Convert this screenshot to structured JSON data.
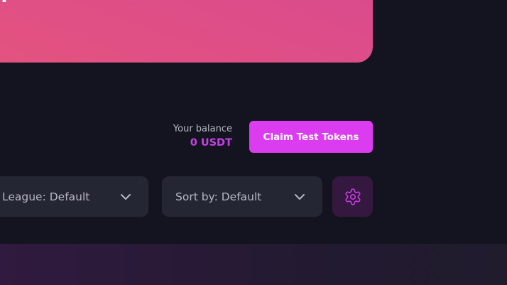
{
  "hero": {
    "title": "!"
  },
  "balance": {
    "label": "Your balance",
    "value": "0 USDT"
  },
  "claim_button": {
    "label": "Claim Test Tokens"
  },
  "filters": {
    "league": {
      "label": "League: Default"
    },
    "sort": {
      "label": "Sort by: Default"
    }
  },
  "icons": {
    "chevron": "chevron-down-icon",
    "settings": "gear-icon"
  },
  "colors": {
    "background": "#13141f",
    "accent": "#dc3cf0",
    "balance_value": "#c741e6",
    "hero_gradient_start": "#d84a8e",
    "hero_gradient_end": "#e4537e",
    "control_background": "#252634",
    "settings_background": "#35183f"
  }
}
